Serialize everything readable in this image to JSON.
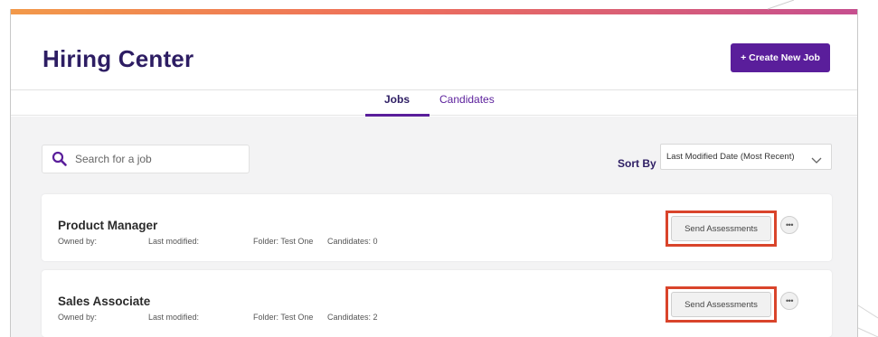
{
  "header": {
    "title": "Hiring Center",
    "create_button": {
      "icon": "plus-icon",
      "label": "+ Create New Job"
    }
  },
  "tabs": [
    {
      "label": "Jobs",
      "active": true
    },
    {
      "label": "Candidates",
      "active": false
    }
  ],
  "search": {
    "placeholder": "Search for a job",
    "icon": "search-icon"
  },
  "sort": {
    "label": "Sort By",
    "value": "Last Modified Date (Most Recent)",
    "icon": "chevron-down-icon"
  },
  "jobs": [
    {
      "title": "Product Manager",
      "owned_by": "Owned by:",
      "last_modified": "Last modified:",
      "folder": "Folder: Test One",
      "candidates": "Candidates: 0",
      "action_label": "Send Assessments",
      "more_label": "•••"
    },
    {
      "title": "Sales Associate",
      "owned_by": "Owned by:",
      "last_modified": "Last modified:",
      "folder": "Folder: Test One",
      "candidates": "Candidates: 2",
      "action_label": "Send Assessments",
      "more_label": "•••"
    }
  ],
  "colors": {
    "brand_purple": "#5a1e9b",
    "title_navy": "#2d1d63",
    "highlight_red": "#d9442b",
    "gradient_start": "#f2994a",
    "gradient_end": "#c64f8f"
  }
}
